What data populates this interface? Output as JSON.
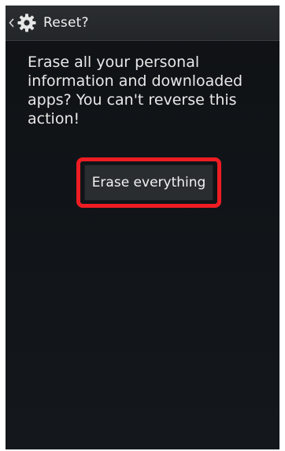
{
  "action_bar": {
    "up_icon": "chevron-left-icon",
    "app_icon": "gear-icon",
    "title": "Reset?"
  },
  "dialog": {
    "message": "Erase all your personal information and downloaded apps? You can't reverse this action!",
    "erase_button_label": "Erase everything"
  },
  "colors": {
    "background": "#111519",
    "action_bar": "#26292c",
    "text": "#e8e8e8",
    "highlight": "#ee1d23",
    "button": "#2a2d30"
  }
}
